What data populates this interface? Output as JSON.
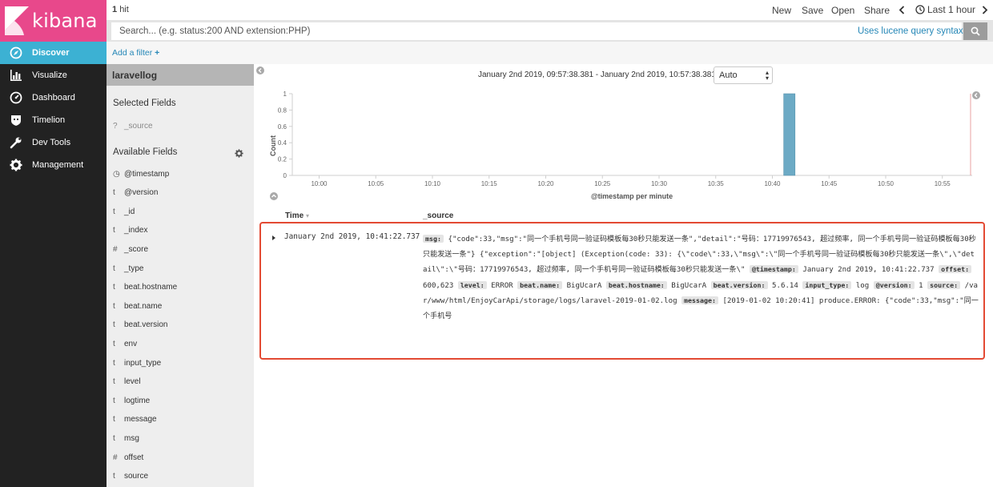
{
  "nav": {
    "logo_text": "kibana",
    "items": [
      {
        "label": "Discover",
        "icon": "compass-icon",
        "active": true
      },
      {
        "label": "Visualize",
        "icon": "bar-chart-icon",
        "active": false
      },
      {
        "label": "Dashboard",
        "icon": "dashboard-gauge-icon",
        "active": false
      },
      {
        "label": "Timelion",
        "icon": "timelion-shield-icon",
        "active": false
      },
      {
        "label": "Dev Tools",
        "icon": "wrench-icon",
        "active": false
      },
      {
        "label": "Management",
        "icon": "gear-icon",
        "active": false
      }
    ]
  },
  "topbar": {
    "hit_count": "1",
    "hit_label": "hit",
    "new_label": "New",
    "save_label": "Save",
    "open_label": "Open",
    "share_label": "Share",
    "time_label": "Last 1 hour"
  },
  "search": {
    "placeholder": "Search... (e.g. status:200 AND extension:PHP)",
    "lucene_link": "Uses lucene query syntax"
  },
  "filter": {
    "add_filter_label": "Add a filter"
  },
  "sidebar": {
    "index_pattern": "laravellog",
    "selected_title": "Selected Fields",
    "selected_fields": [
      {
        "type": "?",
        "name": "_source"
      }
    ],
    "available_title": "Available Fields",
    "available_fields": [
      {
        "type": "◷",
        "name": "@timestamp"
      },
      {
        "type": "t",
        "name": "@version"
      },
      {
        "type": "t",
        "name": "_id"
      },
      {
        "type": "t",
        "name": "_index"
      },
      {
        "type": "#",
        "name": "_score"
      },
      {
        "type": "t",
        "name": "_type"
      },
      {
        "type": "t",
        "name": "beat.hostname"
      },
      {
        "type": "t",
        "name": "beat.name"
      },
      {
        "type": "t",
        "name": "beat.version"
      },
      {
        "type": "t",
        "name": "env"
      },
      {
        "type": "t",
        "name": "input_type"
      },
      {
        "type": "t",
        "name": "level"
      },
      {
        "type": "t",
        "name": "logtime"
      },
      {
        "type": "t",
        "name": "message"
      },
      {
        "type": "t",
        "name": "msg"
      },
      {
        "type": "#",
        "name": "offset"
      },
      {
        "type": "t",
        "name": "source"
      }
    ]
  },
  "main": {
    "time_range": "January 2nd 2019, 09:57:38.381 - January 2nd 2019, 10:57:38.381 —",
    "interval": "Auto"
  },
  "chart_data": {
    "type": "bar",
    "title": "",
    "xlabel": "@timestamp per minute",
    "ylabel": "Count",
    "x_ticks": [
      "10:00",
      "10:05",
      "10:10",
      "10:15",
      "10:20",
      "10:25",
      "10:30",
      "10:35",
      "10:40",
      "10:45",
      "10:50",
      "10:55"
    ],
    "y_ticks": [
      "0",
      "0.2",
      "0.4",
      "0.6",
      "0.8",
      "1"
    ],
    "ylim": [
      0,
      1
    ],
    "xlim": [
      "09:57:38",
      "10:57:38"
    ],
    "bars": [
      {
        "x": "10:41",
        "value": 1
      }
    ],
    "bar_color": "#6caac5",
    "grid": false
  },
  "table": {
    "col_time": "Time",
    "col_source": "_source",
    "rows": [
      {
        "time": "January 2nd 2019, 10:41:22.737",
        "source_fields": [
          {
            "key": "msg:",
            "value": "{\"code\":33,\"msg\":\"同一个手机号同一验证码模板每30秒只能发送一条\",\"detail\":\"号码：17719976543, 超过频率, 同一个手机号同一验证码模板每30秒只能发送一条\"} {\"exception\":\"[object] (Exception(code: 33): {\\\"code\\\":33,\\\"msg\\\":\\\"同一个手机号同一验证码模板每30秒只能发送一条\\\",\\\"detail\\\":\\\"号码：17719976543, 超过频率, 同一个手机号同一验证码模板每30秒只能发送一条\\\""
          },
          {
            "key": "@timestamp:",
            "value": "January 2nd 2019, 10:41:22.737"
          },
          {
            "key": "offset:",
            "value": "600,623"
          },
          {
            "key": "level:",
            "value": "ERROR"
          },
          {
            "key": "beat.name:",
            "value": "BigUcarA"
          },
          {
            "key": "beat.hostname:",
            "value": "BigUcarA"
          },
          {
            "key": "beat.version:",
            "value": "5.6.14"
          },
          {
            "key": "input_type:",
            "value": "log"
          },
          {
            "key": "@version:",
            "value": "1"
          },
          {
            "key": "source:",
            "value": "/var/www/html/EnjoyCarApi/storage/logs/laravel-2019-01-02.log"
          },
          {
            "key": "message:",
            "value": "[2019-01-02 10:20:41] produce.ERROR: {\"code\":33,\"msg\":\"同一个手机号"
          }
        ]
      }
    ]
  },
  "colors": {
    "nav_bg": "#222222",
    "logo_bg": "#e8488b",
    "active_nav": "#3cb1d3",
    "link": "#2587b7",
    "highlight_border": "#e34a33"
  }
}
